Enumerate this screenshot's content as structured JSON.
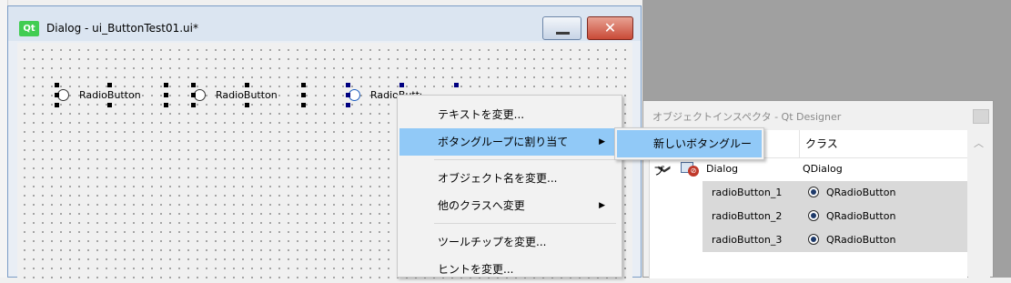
{
  "dialog": {
    "logo": "Qt",
    "title": "Dialog - ui_ButtonTest01.ui*",
    "close_glyph": "✕",
    "radio_labels": [
      "RadioButton",
      "RadioButton",
      "RadioButton"
    ]
  },
  "context_menu": {
    "items": [
      {
        "label": "テキストを変更..."
      },
      {
        "label": "ボタングループに割り当て",
        "arrow": "▶"
      },
      {
        "label": "オブジェクト名を変更..."
      },
      {
        "label": "他のクラスへ変更",
        "arrow": "▶"
      },
      {
        "label": "ツールチップを変更..."
      },
      {
        "label": "ヒントを変更..."
      }
    ]
  },
  "submenu": {
    "items": [
      {
        "label": "新しいボタングループ"
      }
    ]
  },
  "inspector": {
    "title": "オブジェクトインスペクタ - Qt Designer",
    "columns": [
      "",
      "クラス"
    ],
    "root": {
      "name": "Dialog",
      "class": "QDialog",
      "expander": "❯"
    },
    "children": [
      {
        "name": "radioButton_1",
        "class": "QRadioButton"
      },
      {
        "name": "radioButton_2",
        "class": "QRadioButton"
      },
      {
        "name": "radioButton_3",
        "class": "QRadioButton"
      }
    ],
    "scroll_up": "︿"
  },
  "colors": {
    "menu_highlight": "#91c9f7",
    "qt_green": "#41cd52",
    "close_red": "#c94a37",
    "selected_row": "#d9d9d9"
  },
  "icons": [
    "qt-logo-icon",
    "minimize-icon",
    "close-icon",
    "chevron-right-icon",
    "expand-chevron-icon",
    "dialog-icon",
    "radio-button-icon",
    "scroll-up-icon"
  ]
}
